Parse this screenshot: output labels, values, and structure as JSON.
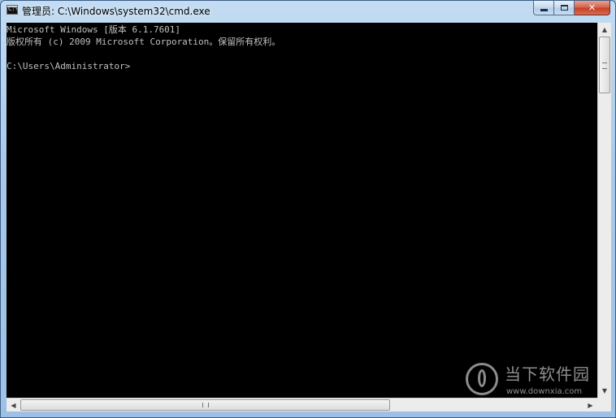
{
  "window": {
    "title": "管理员: C:\\Windows\\system32\\cmd.exe",
    "icon": "cmd-console-icon",
    "buttons": {
      "minimize": "minimize-icon",
      "maximize": "maximize-icon",
      "close": "✕"
    }
  },
  "console": {
    "lines": [
      "Microsoft Windows [版本 6.1.7601]",
      "版权所有 (c) 2009 Microsoft Corporation。保留所有权利。",
      "",
      "C:\\Users\\Administrator>"
    ],
    "background": "#000000",
    "foreground": "#c0c0c0"
  },
  "scrollbars": {
    "up_arrow": "▲",
    "down_arrow": "▼",
    "left_arrow": "◀",
    "right_arrow": "▶"
  },
  "watermark": {
    "name": "当下软件园",
    "url": "www.downxia.com"
  }
}
